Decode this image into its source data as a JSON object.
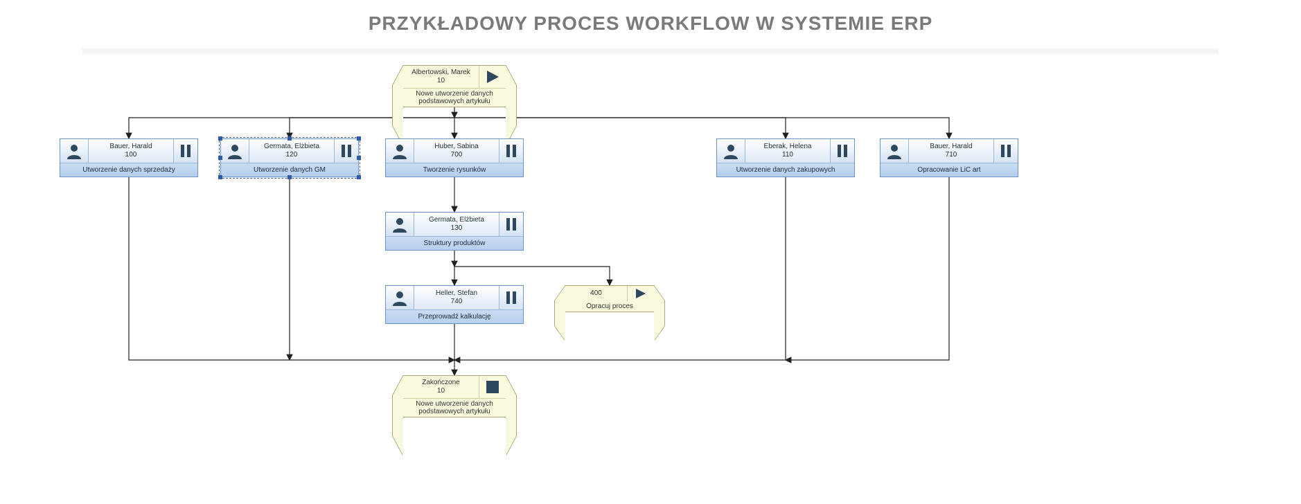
{
  "page": {
    "title": "PRZYKŁADOWY PROCES WORKFLOW W SYSTEMIE ERP"
  },
  "start": {
    "name": "Albertowski, Marek",
    "code": "10",
    "desc": "Nowe utworzenie danych podstawowych artykułu"
  },
  "tasks": {
    "t100": {
      "name": "Bauer, Harald",
      "code": "100",
      "desc": "Utworzenie danych sprzedaży"
    },
    "t120": {
      "name": "Germata, Elżbieta",
      "code": "120",
      "desc": "Utworzenie danych GM"
    },
    "t700": {
      "name": "Huber, Sabina",
      "code": "700",
      "desc": "Tworzenie rysunków"
    },
    "t110": {
      "name": "Eberak, Helena",
      "code": "110",
      "desc": "Utworzenie danych zakupowych"
    },
    "t710": {
      "name": "Bauer, Harald",
      "code": "710",
      "desc": "Opracowanie LiC art"
    },
    "t130": {
      "name": "Germata, Elżbieta",
      "code": "130",
      "desc": "Struktury produktów"
    },
    "t740": {
      "name": "Heller, Stefan",
      "code": "740",
      "desc": "Przeprowadź kalkulację"
    }
  },
  "subprocess": {
    "code": "400",
    "desc": "Opracuj proces"
  },
  "end": {
    "name": "Zakończone",
    "code": "10",
    "desc": "Nowe utworzenie danych podstawowych artykułu"
  }
}
